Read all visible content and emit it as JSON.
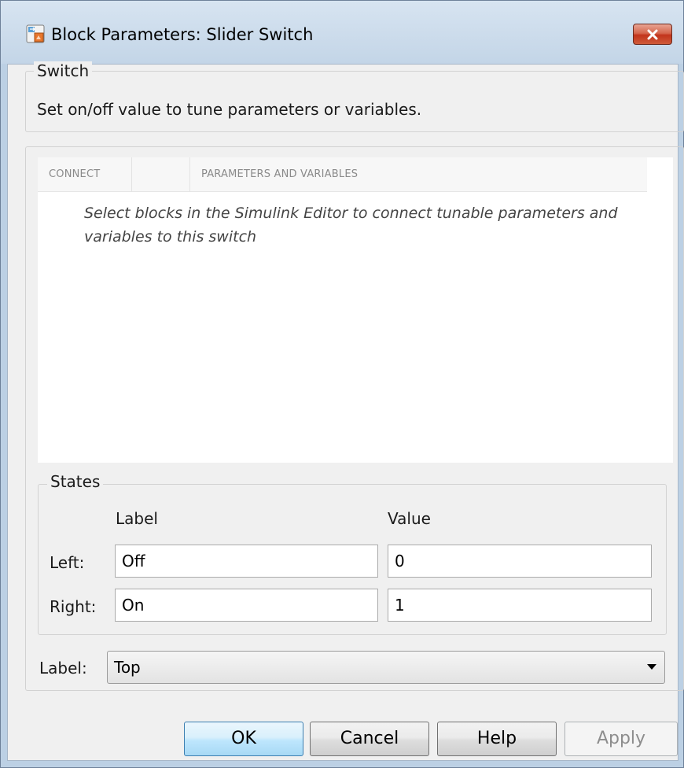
{
  "window": {
    "title": "Block Parameters: Slider Switch",
    "close_icon": "close-icon"
  },
  "switch_group": {
    "legend": "Switch",
    "description": "Set on/off value to tune parameters or variables."
  },
  "table": {
    "columns": [
      "CONNECT",
      "",
      "PARAMETERS AND VARIABLES"
    ],
    "hint": "Select blocks in the Simulink Editor to connect tunable parameters and variables to this switch"
  },
  "states": {
    "legend": "States",
    "label_header": "Label",
    "value_header": "Value",
    "rows": [
      {
        "name": "Left:",
        "label": "Off",
        "value": "0"
      },
      {
        "name": "Right:",
        "label": "On",
        "value": "1"
      }
    ]
  },
  "label_select": {
    "label": "Label:",
    "selected": "Top"
  },
  "buttons": {
    "ok": "OK",
    "cancel": "Cancel",
    "help": "Help",
    "apply": "Apply"
  },
  "colors": {
    "titlebar": "#c3d5e7",
    "close_button": "#c2341c",
    "dialog_background": "#f0f0f0",
    "ok_button": "#bee6fd"
  }
}
